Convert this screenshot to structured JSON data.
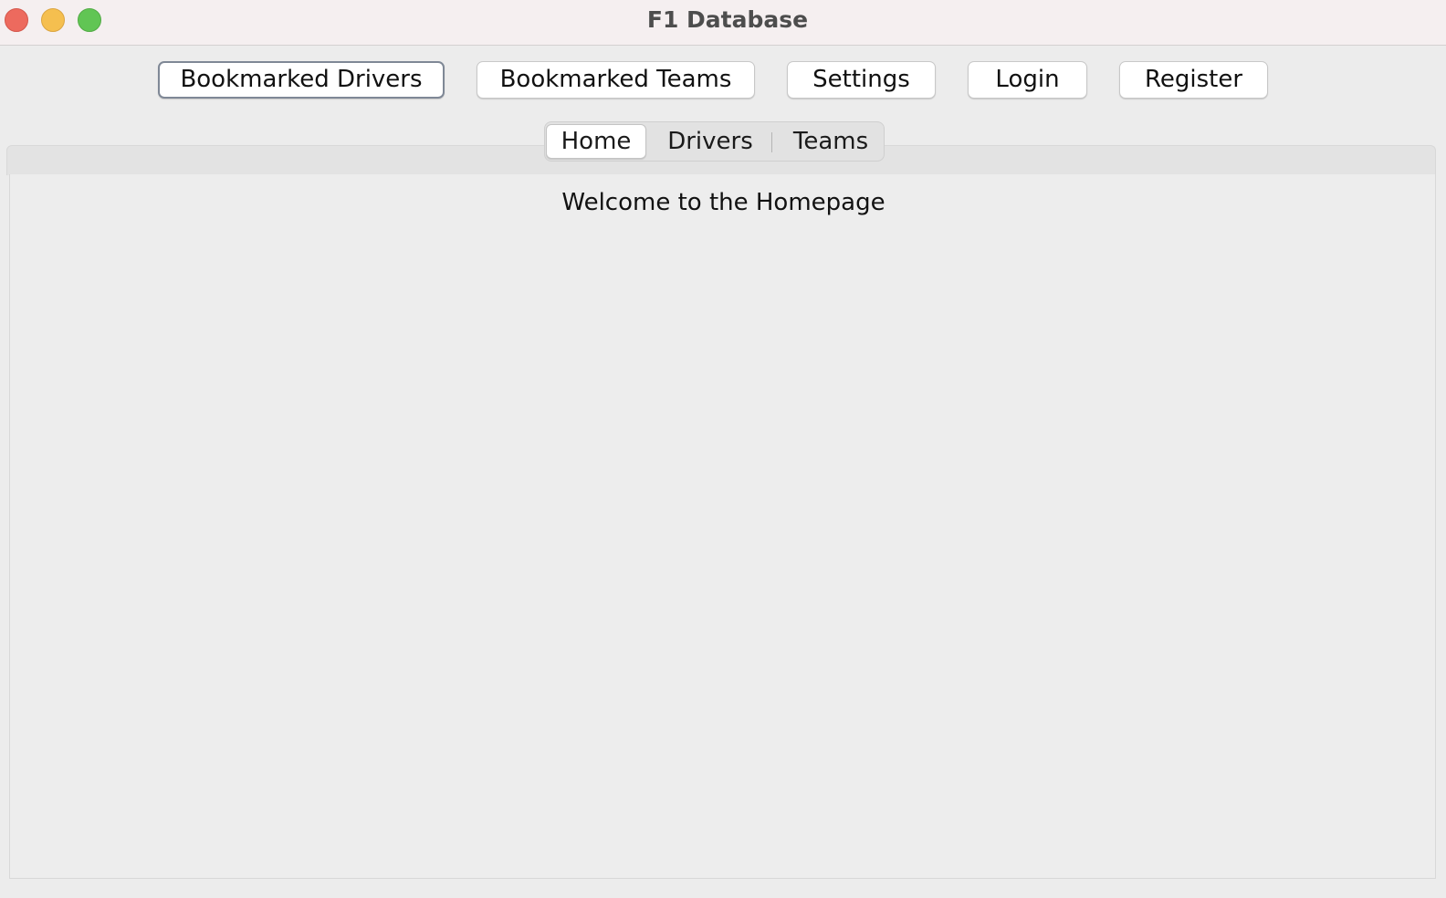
{
  "window": {
    "title": "F1 Database"
  },
  "toolbar": {
    "bookmarked_drivers": "Bookmarked Drivers",
    "bookmarked_teams": "Bookmarked Teams",
    "settings": "Settings",
    "login": "Login",
    "register": "Register"
  },
  "tabs": [
    {
      "label": "Home",
      "selected": true
    },
    {
      "label": "Drivers",
      "selected": false
    },
    {
      "label": "Teams",
      "selected": false
    }
  ],
  "home": {
    "welcome_text": "Welcome to the Homepage"
  },
  "colors": {
    "close": "#ed6a5e",
    "minimize": "#f5bf4f",
    "maximize": "#61c554"
  }
}
